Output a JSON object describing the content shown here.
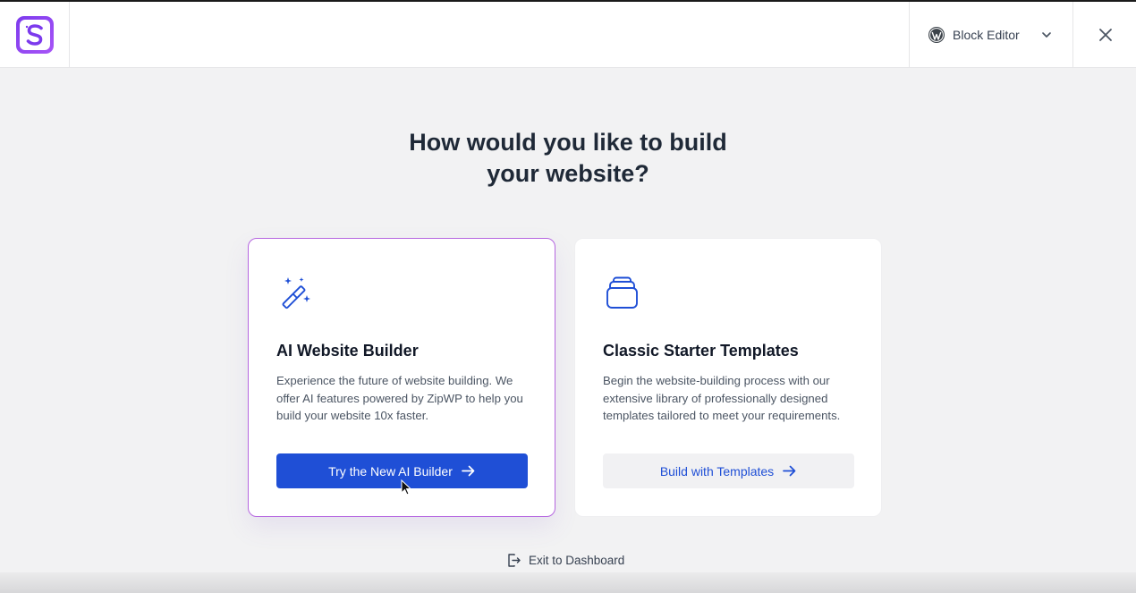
{
  "header": {
    "editor_select_label": "Block Editor"
  },
  "heading": {
    "line1": "How would you like to build",
    "line2": "your website?"
  },
  "cards": [
    {
      "title": "AI Website Builder",
      "description": "Experience the future of website building. We offer AI features powered by ZipWP to help you build your website 10x faster.",
      "button_label": "Try the New AI Builder",
      "icon": "magic-wand-icon"
    },
    {
      "title": "Classic Starter Templates",
      "description": "Begin the website-building process with our extensive library of professionally designed templates tailored to meet your requirements.",
      "button_label": "Build with Templates",
      "icon": "template-stack-icon"
    }
  ],
  "footer": {
    "exit_label": "Exit to Dashboard"
  },
  "colors": {
    "primary": "#1f4fd6",
    "brand": "#7c3aed",
    "selected_border": "#b667e0"
  }
}
